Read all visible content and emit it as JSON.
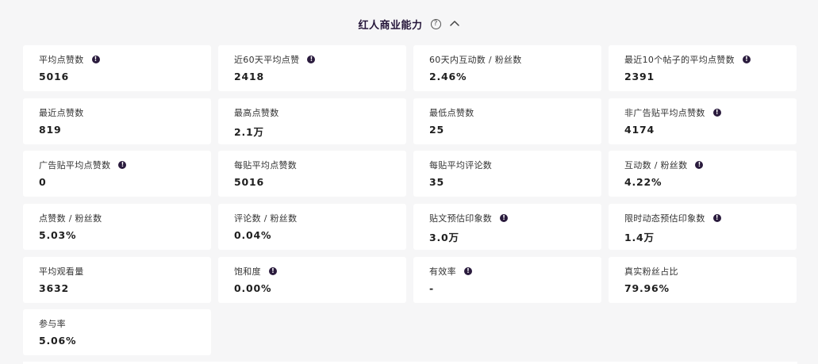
{
  "section": {
    "title": "红人商业能力",
    "help": "?"
  },
  "info_glyph": "!",
  "metrics": [
    {
      "label": "平均点赞数",
      "value": "5016",
      "info": true
    },
    {
      "label": "近60天平均点赞",
      "value": "2418",
      "info": true
    },
    {
      "label": "60天内互动数 / 粉丝数",
      "value": "2.46%",
      "info": false
    },
    {
      "label": "最近10个帖子的平均点赞数",
      "value": "2391",
      "info": true
    },
    {
      "label": "最近点赞数",
      "value": "819",
      "info": false
    },
    {
      "label": "最高点赞数",
      "value": "2.1万",
      "info": false
    },
    {
      "label": "最低点赞数",
      "value": "25",
      "info": false
    },
    {
      "label": "非广告贴平均点赞数",
      "value": "4174",
      "info": true
    },
    {
      "label": "广告贴平均点赞数",
      "value": "0",
      "info": true
    },
    {
      "label": "每贴平均点赞数",
      "value": "5016",
      "info": false
    },
    {
      "label": "每贴平均评论数",
      "value": "35",
      "info": false
    },
    {
      "label": "互动数 / 粉丝数",
      "value": "4.22%",
      "info": true
    },
    {
      "label": "点赞数 / 粉丝数",
      "value": "5.03%",
      "info": false
    },
    {
      "label": "评论数 / 粉丝数",
      "value": "0.04%",
      "info": false
    },
    {
      "label": "贴文预估印象数",
      "value": "3.0万",
      "info": true
    },
    {
      "label": "限时动态预估印象数",
      "value": "1.4万",
      "info": true
    },
    {
      "label": "平均观看量",
      "value": "3632",
      "info": false
    },
    {
      "label": "饱和度",
      "value": "0.00%",
      "info": true
    },
    {
      "label": "有效率",
      "value": "-",
      "info": true
    },
    {
      "label": "真实粉丝占比",
      "value": "79.96%",
      "info": false
    },
    {
      "label": "参与率",
      "value": "5.06%",
      "info": false
    }
  ]
}
